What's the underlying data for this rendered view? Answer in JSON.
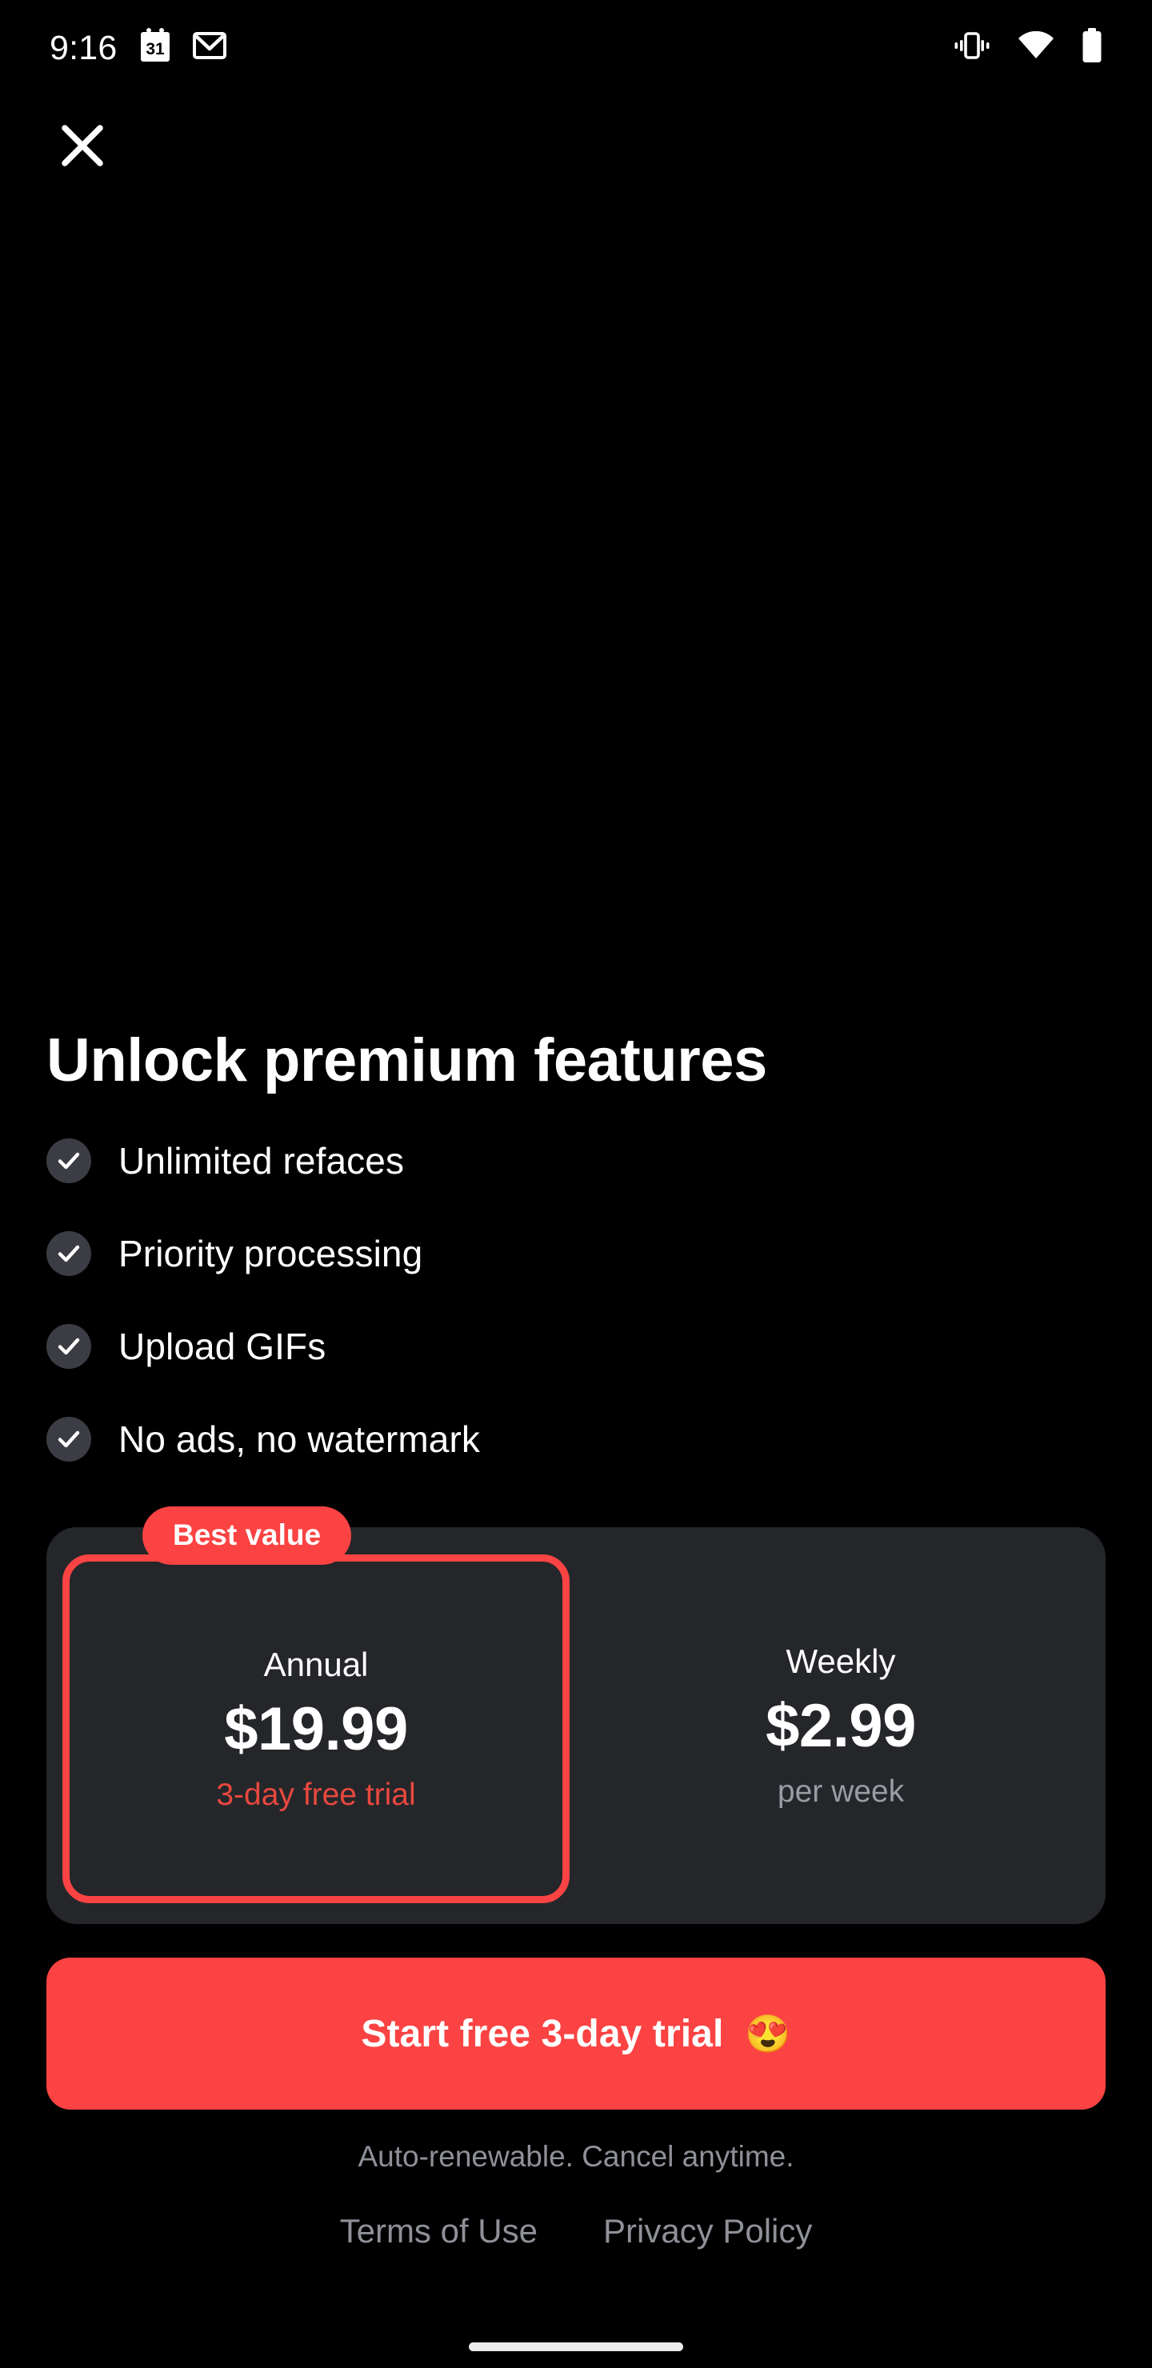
{
  "status_bar": {
    "time": "9:16",
    "left_icons": [
      {
        "name": "calendar-icon",
        "day": "31"
      },
      {
        "name": "gmail-icon"
      }
    ],
    "right_icons": [
      {
        "name": "vibrate-icon"
      },
      {
        "name": "wifi-icon"
      },
      {
        "name": "battery-icon"
      }
    ]
  },
  "header": {
    "close_label": "Close",
    "close_icon": "close-icon"
  },
  "main": {
    "title": "Unlock premium features",
    "features": [
      {
        "label": "Unlimited refaces",
        "icon": "check-icon"
      },
      {
        "label": "Priority processing",
        "icon": "check-icon"
      },
      {
        "label": "Upload GIFs",
        "icon": "check-icon"
      },
      {
        "label": "No ads, no watermark",
        "icon": "check-icon"
      }
    ],
    "badge": "Best value",
    "plans": [
      {
        "name": "Annual",
        "price": "$19.99",
        "sub": "3-day free trial",
        "selected": true
      },
      {
        "name": "Weekly",
        "price": "$2.99",
        "sub": "per week",
        "selected": false
      }
    ],
    "cta": {
      "label": "Start free 3-day trial",
      "emoji": "😍"
    }
  },
  "footer": {
    "auto_renew": "Auto-renewable. Cancel anytime.",
    "terms_label": "Terms of Use",
    "privacy_label": "Privacy Policy"
  },
  "colors": {
    "background": "#000000",
    "accent_red": "#fb4343",
    "trial_red": "#e8483f",
    "card_bg": "#25262a",
    "badge_circle": "#3c3d44",
    "muted_text": "#8f9199"
  }
}
